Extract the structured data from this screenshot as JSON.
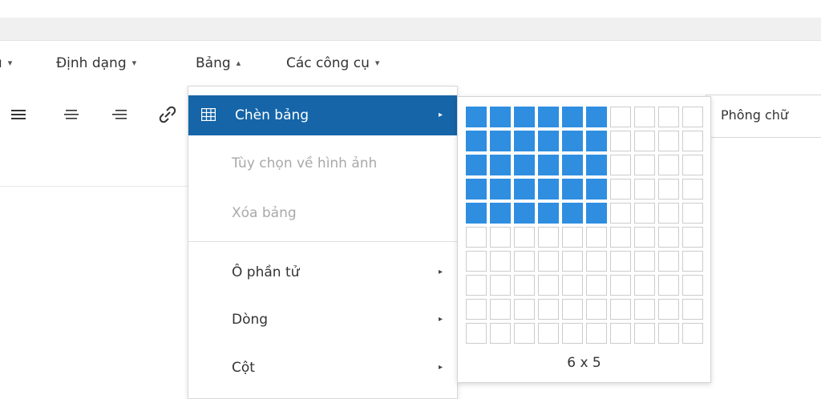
{
  "menubar": {
    "items": [
      {
        "label": "ı",
        "arrow": "▾"
      },
      {
        "label": "Định dạng",
        "arrow": "▾"
      },
      {
        "label": "Bảng",
        "arrow": "▴"
      },
      {
        "label": "Các công cụ",
        "arrow": "▾"
      }
    ]
  },
  "toolbar": {
    "icons": [
      "align-justify-icon",
      "align-center-icon",
      "align-right-icon",
      "link-icon"
    ],
    "font_select_label": "Phông chữ"
  },
  "table_menu": {
    "items": [
      {
        "label": "Chèn bảng",
        "icon": "table-grid-icon",
        "submenu": true,
        "state": "active"
      },
      {
        "label": "Tùy chọn về hình ảnh",
        "submenu": false,
        "state": "disabled"
      },
      {
        "label": "Xóa bảng",
        "submenu": false,
        "state": "disabled"
      },
      {
        "label": "Ô phần tử",
        "submenu": true,
        "state": "normal"
      },
      {
        "label": "Dòng",
        "submenu": true,
        "state": "normal"
      },
      {
        "label": "Cột",
        "submenu": true,
        "state": "normal"
      }
    ],
    "submenu_arrow": "▸"
  },
  "table_picker": {
    "columns": 10,
    "rows": 10,
    "selected_columns": 6,
    "selected_rows": 5,
    "size_label": "6 x 5"
  },
  "colors": {
    "accent": "#1565a8",
    "grid_selected": "#2f8ee0",
    "grid_border": "#cccccc",
    "disabled_text": "#a9a9a9"
  }
}
